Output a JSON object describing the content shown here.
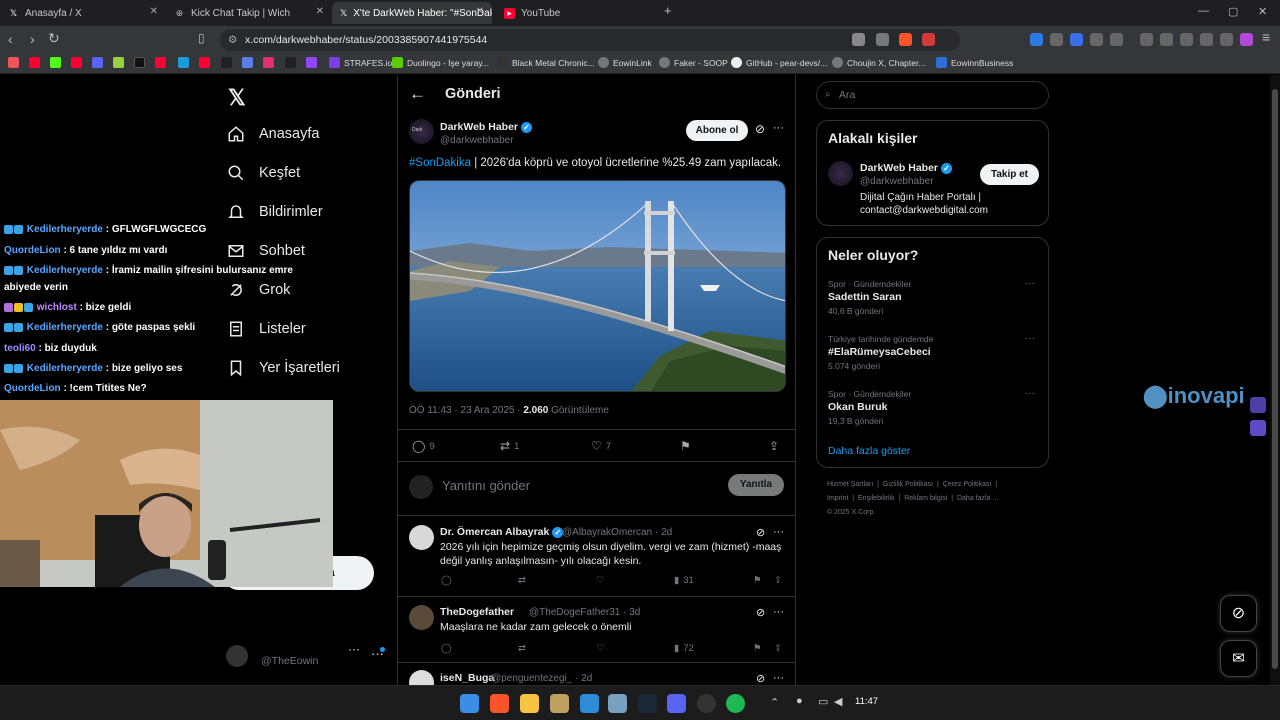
{
  "browser": {
    "tabs": [
      {
        "label": "Anasayfa / X",
        "icon": "x-icon"
      },
      {
        "label": "Kick Chat Takip | Wich",
        "icon": "globe-icon"
      },
      {
        "label": "X'te DarkWeb Haber: \"#SonDaki",
        "icon": "x-icon",
        "active": true
      },
      {
        "label": "YouTube",
        "icon": "youtube-icon"
      }
    ],
    "url": "x.com/darkwebhaber/status/2003385907441975544",
    "bookmarks": [
      "STRAFES.io",
      "Duolingo - İşe yaray...",
      "Black Metal Chronic...",
      "EowinLink",
      "Faker - SOOP",
      "GitHub - pear-devs/...",
      "Chouįin X, Chapter...",
      "EowinnBusiness"
    ]
  },
  "sidebar": {
    "nav": [
      "Anasayfa",
      "Keşfet",
      "Bildirimler",
      "Sohbet",
      "Grok",
      "Listeler",
      "Yer İşaretleri"
    ],
    "account_handle": "@TheEowin",
    "post_fragment": "a"
  },
  "header": {
    "title": "Gönderi"
  },
  "tweet": {
    "author": "DarkWeb Haber",
    "handle": "@darkwebhaber",
    "subscribe": "Abone ol",
    "hashtag": "#SonDakika",
    "text": " | 2026'da köprü ve otoyol ücretlerine %25.49 zam yapılacak.",
    "time": "ÖÖ 11:43 · 23 Ara 2025 · ",
    "views": "2.060",
    "views_label": " Görüntüleme",
    "replies": "9",
    "reposts": "1",
    "likes": "7"
  },
  "reply_box": {
    "placeholder": "Yanıtını gönder",
    "button": "Yanıtla"
  },
  "replies": [
    {
      "name": "Dr. Ömercan Albayrak",
      "handle": "@AlbayrakOmercan · 2d",
      "text1": "2026 yılı için hepimize geçmiş olsun diyelim. vergi ve zam (hizmet) -maaş",
      "text2": "değil yanlış anlaşılmasın- yılı olacağı kesin.",
      "views": "31"
    },
    {
      "name": "TheDogefather",
      "handle": "@TheDogeFather31 · 3d",
      "text1": "Maaşlara ne kadar zam gelecek o önemli",
      "text2": "",
      "views": "72"
    },
    {
      "name": "iseN_Buga",
      "handle": "@penguentezegi_ · 2d",
      "text1": "",
      "text2": "",
      "views": ""
    }
  ],
  "right": {
    "search_placeholder": "Ara",
    "related_title": "Alakalı kişiler",
    "related": {
      "name": "DarkWeb Haber",
      "handle": "@darkwebhaber",
      "bio1": "Dijital Çağın Haber Portalı |",
      "bio2": "contact@darkwebdigital.com",
      "follow": "Takip et"
    },
    "trends_title": "Neler oluyor?",
    "trends": [
      {
        "context": "Spor · Gündemdekiler",
        "name": "Sadettin Saran",
        "count": "40,6 B gönderi"
      },
      {
        "context": "Türkiye tarihinde gündemde",
        "name": "#ElaRümeysaCebeci",
        "count": "5.074 gönderi"
      },
      {
        "context": "Spor · Gündemdekiler",
        "name": "Okan Buruk",
        "count": "19,3 B gönderi"
      }
    ],
    "show_more": "Daha fazla göster",
    "footer1": [
      "Hizmet Şartları",
      "Gizlilik Politikası",
      "Çerez Politikası"
    ],
    "footer2": [
      "Imprint",
      "Erişilebilirlik",
      "Reklam bilgisi",
      "Daha fazla ..."
    ],
    "copyright": "© 2025 X Corp."
  },
  "chat": [
    {
      "user": "Kedilerheryerde",
      "msg": " : GFLWGFLWGCECG",
      "badges": 2
    },
    {
      "user": "QuordeLion",
      "msg": " : 6 tane yıldız mı vardı",
      "badges": 0
    },
    {
      "user": "Kedilerheryerde",
      "msg": " : İramiz mailin şifresini bulursanız emre",
      "badges": 2
    },
    {
      "user": "",
      "msg": "abiyede verin",
      "badges": 0
    },
    {
      "user": "wichlost",
      "msg": " : bize geldi",
      "badges": 3
    },
    {
      "user": "Kedilerheryerde",
      "msg": " : göte paspas şekli",
      "badges": 2
    },
    {
      "user": "teoli60",
      "msg": " : biz duyduk",
      "badges": 0
    },
    {
      "user": "Kedilerheryerde",
      "msg": " : bize geliyo ses",
      "badges": 2
    },
    {
      "user": "QuordeLion",
      "msg": " : !cem Titites Ne?",
      "badges": 0
    }
  ],
  "watermark": "inovapi",
  "clock": "11:47"
}
